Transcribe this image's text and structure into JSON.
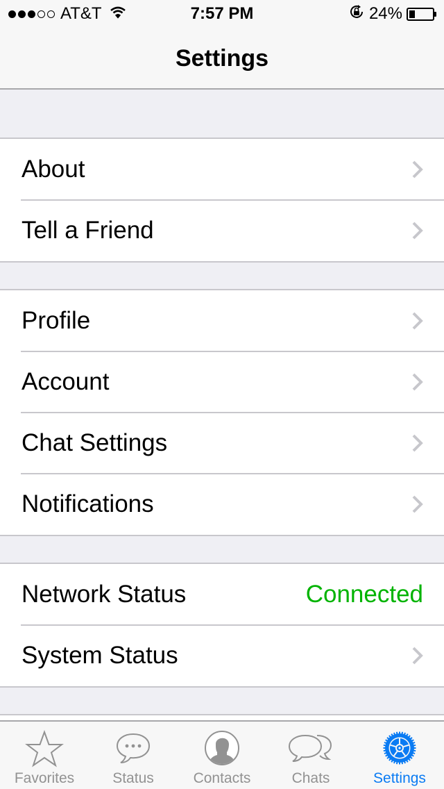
{
  "status_bar": {
    "signal_strength": "3 of 5",
    "carrier": "AT&T",
    "time": "7:57 PM",
    "battery_percent": "24%",
    "battery_level": 0.24,
    "icons": [
      "signal-dots-icon",
      "wifi-icon",
      "rotation-lock-icon",
      "battery-icon"
    ]
  },
  "nav": {
    "title": "Settings"
  },
  "sections": [
    {
      "rows": [
        {
          "label": "About",
          "accessory": "chevron-right-icon"
        },
        {
          "label": "Tell a Friend",
          "accessory": "chevron-right-icon"
        }
      ]
    },
    {
      "rows": [
        {
          "label": "Profile",
          "accessory": "chevron-right-icon"
        },
        {
          "label": "Account",
          "accessory": "chevron-right-icon"
        },
        {
          "label": "Chat Settings",
          "accessory": "chevron-right-icon"
        },
        {
          "label": "Notifications",
          "accessory": "chevron-right-icon"
        }
      ]
    },
    {
      "rows": [
        {
          "label": "Network Status",
          "value": "Connected",
          "value_color": "#00b300"
        },
        {
          "label": "System Status",
          "accessory": "chevron-right-icon"
        }
      ]
    }
  ],
  "tab_bar": {
    "active": "Settings",
    "active_color": "#0a7bf3",
    "inactive_color": "#929292",
    "tabs": [
      {
        "label": "Favorites",
        "icon": "star-icon"
      },
      {
        "label": "Status",
        "icon": "speech-bubble-icon"
      },
      {
        "label": "Contacts",
        "icon": "contact-avatar-icon"
      },
      {
        "label": "Chats",
        "icon": "chat-bubbles-icon"
      },
      {
        "label": "Settings",
        "icon": "gear-icon"
      }
    ]
  }
}
